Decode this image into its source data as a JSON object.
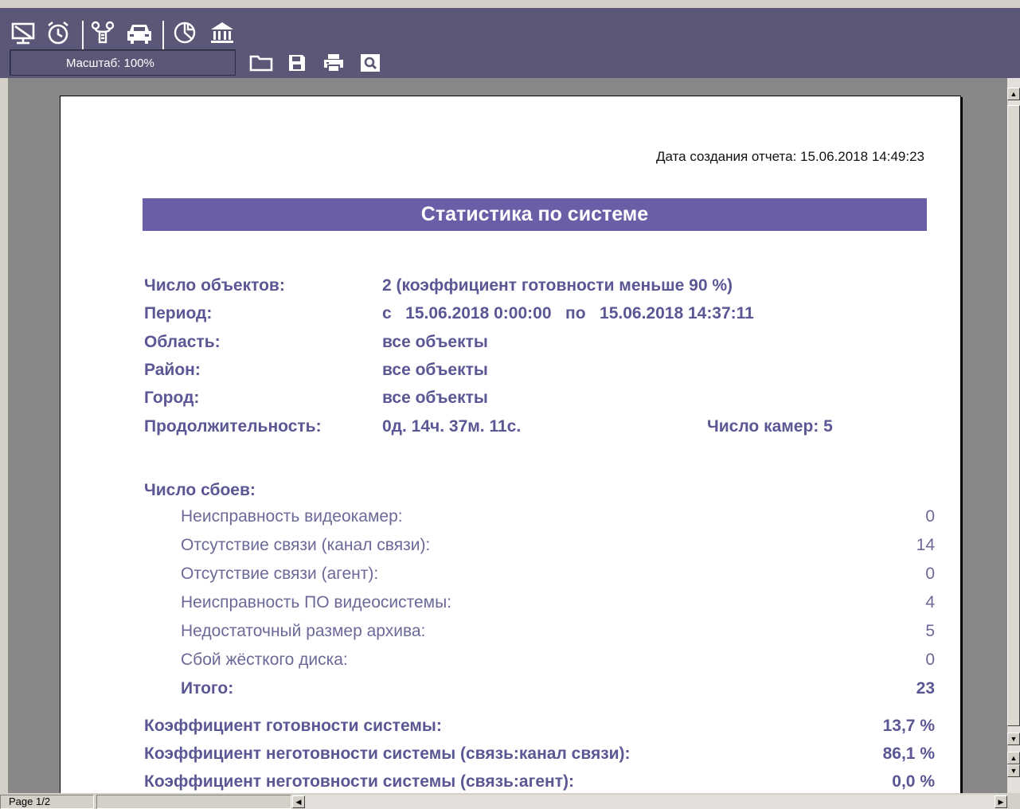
{
  "toolbar": {
    "icons": [
      "monitor-icon",
      "alarm-clock-icon",
      "network-icon",
      "car-icon",
      "pie-chart-icon",
      "bank-icon"
    ],
    "scale_label": "Масштаб: 100%",
    "file_icons": [
      "folder-icon",
      "save-icon",
      "print-icon",
      "preview-icon"
    ]
  },
  "report": {
    "date_line": "Дата создания отчета: 15.06.2018 14:49:23",
    "title": "Статистика по системе",
    "info": [
      {
        "label": "Число объектов:",
        "value": "2 (коэффициент готовности меньше 90 %)"
      },
      {
        "label": "Период:",
        "value": "с   15.06.2018 0:00:00   по   15.06.2018 14:37:11"
      },
      {
        "label": "Область:",
        "value": "все объекты"
      },
      {
        "label": "Район:",
        "value": "все объекты"
      },
      {
        "label": "Город:",
        "value": "все объекты"
      },
      {
        "label": "Продолжительность:",
        "value": "0д. 14ч. 37м. 11с."
      }
    ],
    "cameras": "Число камер: 5",
    "failures_title": "Число сбоев:",
    "failures": [
      {
        "label": "Неисправность видеокамер:",
        "value": "0"
      },
      {
        "label": "Отсутствие связи (канал связи):",
        "value": "14"
      },
      {
        "label": "Отсутствие связи (агент):",
        "value": "0"
      },
      {
        "label": "Неисправность ПО видеосистемы:",
        "value": "4"
      },
      {
        "label": "Недостаточный размер архива:",
        "value": "5"
      },
      {
        "label": "Сбой жёсткого диска:",
        "value": "0"
      }
    ],
    "total": {
      "label": "Итого:",
      "value": "23"
    },
    "coefficients": [
      {
        "label": "Коэффициент готовности системы:",
        "value": "13,7 %"
      },
      {
        "label": "Коэффициент неготовности системы (связь:канал связи):",
        "value": "86,1 %"
      },
      {
        "label": "Коэффициент неготовности системы (связь:агент):",
        "value": "0,0 %"
      }
    ]
  },
  "status": {
    "page": "Page 1/2"
  },
  "colors": {
    "toolbar_bg": "#5a5876",
    "header_band": "#6a5fa7",
    "report_text": "#5a5794"
  }
}
